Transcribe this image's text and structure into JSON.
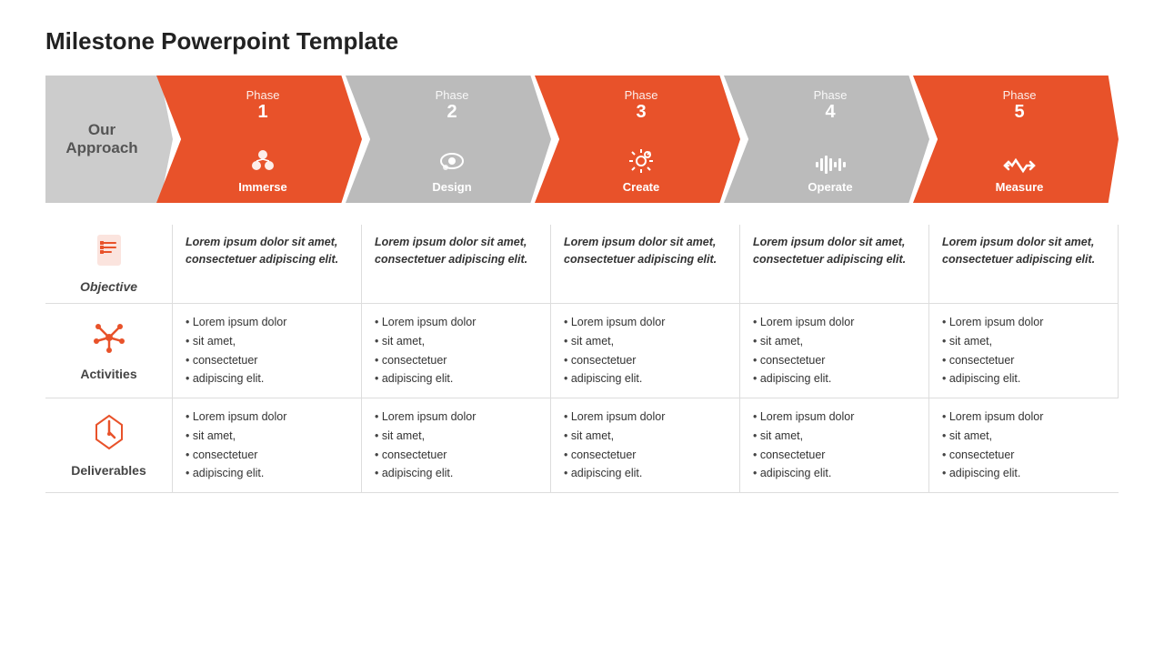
{
  "title": "Milestone Powerpoint Template",
  "approach_label": "Our\nApproach",
  "phases": [
    {
      "id": "phase1",
      "label": "Phase",
      "number": "1",
      "icon": "⚙",
      "icon_unicode": "🔮",
      "name": "Immerse",
      "color": "orange"
    },
    {
      "id": "phase2",
      "label": "Phase",
      "number": "2",
      "icon": "🎨",
      "name": "Design",
      "color": "gray"
    },
    {
      "id": "phase3",
      "label": "Phase",
      "number": "3",
      "icon": "⚙",
      "name": "Create",
      "color": "orange"
    },
    {
      "id": "phase4",
      "label": "Phase",
      "number": "4",
      "icon": "📊",
      "name": "Operate",
      "color": "gray"
    },
    {
      "id": "phase5",
      "label": "Phase",
      "number": "5",
      "icon": "↔",
      "name": "Measure",
      "color": "orange"
    }
  ],
  "rows": [
    {
      "id": "objective",
      "label": "Objective",
      "label_style": "italic",
      "icon": "📋",
      "cell_type": "objective",
      "cells": [
        "Lorem ipsum dolor sit amet, consectetuer adipiscing elit.",
        "Lorem ipsum dolor sit amet, consectetuer adipiscing elit.",
        "Lorem ipsum dolor sit amet, consectetuer adipiscing elit.",
        "Lorem ipsum dolor sit amet, consectetuer adipiscing elit.",
        "Lorem ipsum dolor sit amet, consectetuer adipiscing elit."
      ]
    },
    {
      "id": "activities",
      "label": "Activities",
      "icon": "🌟",
      "cell_type": "list",
      "cells": [
        [
          "Lorem ipsum dolor",
          "sit amet,",
          "consectetuer",
          "adipiscing elit."
        ],
        [
          "Lorem ipsum dolor",
          "sit amet,",
          "consectetuer",
          "adipiscing elit."
        ],
        [
          "Lorem ipsum dolor",
          "sit amet,",
          "consectetuer",
          "adipiscing elit."
        ],
        [
          "Lorem ipsum dolor",
          "sit amet,",
          "consectetuer",
          "adipiscing elit."
        ],
        [
          "Lorem ipsum dolor",
          "sit amet,",
          "consectetuer",
          "adipiscing elit."
        ]
      ]
    },
    {
      "id": "deliverables",
      "label": "Deliverables",
      "icon": "⏳",
      "cell_type": "list",
      "cells": [
        [
          "Lorem ipsum dolor",
          "sit amet,",
          "consectetuer",
          "adipiscing elit."
        ],
        [
          "Lorem ipsum dolor",
          "sit amet,",
          "consectetuer",
          "adipiscing elit."
        ],
        [
          "Lorem ipsum dolor",
          "sit amet,",
          "consectetuer",
          "adipiscing elit."
        ],
        [
          "Lorem ipsum dolor",
          "sit amet,",
          "consectetuer",
          "adipiscing elit."
        ],
        [
          "Lorem ipsum dolor",
          "sit amet,",
          "consectetuer",
          "adipiscing elit."
        ]
      ]
    }
  ],
  "colors": {
    "orange": "#E8522A",
    "gray": "#bbb",
    "dark_gray": "#ccc",
    "text": "#333"
  }
}
